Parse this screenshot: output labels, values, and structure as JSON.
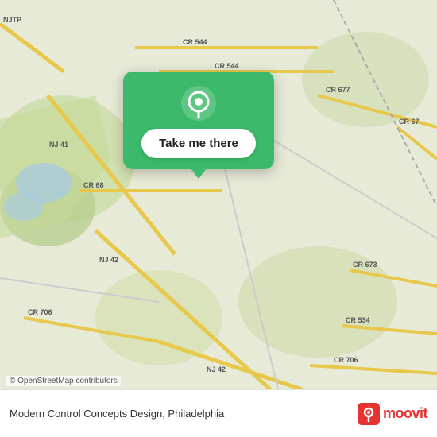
{
  "map": {
    "background_color": "#e8f0d8",
    "popup": {
      "button_label": "Take me there",
      "pin_icon": "location-pin-icon",
      "bg_color": "#3cb96a"
    },
    "osm_credit": "© OpenStreetMap contributors",
    "road_labels": [
      "NJTP",
      "NJ 41",
      "CR 68",
      "NJ 42",
      "CR 706",
      "NJ 42",
      "CR 544",
      "CR 544",
      "CR 677",
      "CR 67",
      "CR 673",
      "CR 534",
      "CR 706"
    ]
  },
  "bottom_bar": {
    "text": "Modern Control Concepts Design, Philadelphia",
    "logo_text": "moovit"
  }
}
